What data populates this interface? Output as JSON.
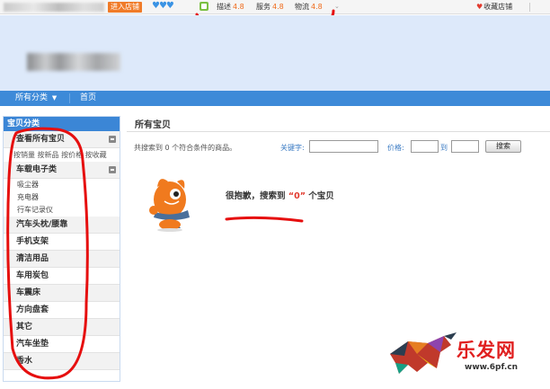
{
  "topbar": {
    "enter_shop": "进入店铺",
    "hearts": "♥♥♥",
    "ratings": [
      {
        "label": "描述",
        "value": "4.8"
      },
      {
        "label": "服务",
        "value": "4.8"
      },
      {
        "label": "物流",
        "value": "4.8"
      }
    ],
    "favorite_label": "收藏店铺"
  },
  "nav": {
    "all_categories": "所有分类",
    "home": "首页"
  },
  "sidebar": {
    "title": "宝贝分类",
    "view_all": "查看所有宝贝",
    "sort_links": "按销量 按新品 按价格 按收藏",
    "categories": [
      {
        "label": "车载电子类",
        "subs": [
          "吸尘器",
          "充电器",
          "行车记录仪"
        ]
      },
      {
        "label": "汽车头枕/腰靠"
      },
      {
        "label": "手机支架"
      },
      {
        "label": "清洁用品"
      },
      {
        "label": "车用炭包"
      },
      {
        "label": "车震床"
      },
      {
        "label": "方向盘套"
      },
      {
        "label": "其它"
      },
      {
        "label": "汽车坐垫"
      },
      {
        "label": "香水"
      }
    ]
  },
  "main": {
    "title": "所有宝贝",
    "result_count": "共搜索到 0 个符合条件的商品。",
    "keyword_label": "关键字:",
    "price_label": "价格:",
    "to_label": "到",
    "search_button": "搜索",
    "sorry_prefix": "很抱歉，搜索到 ",
    "sorry_open_quote": "“",
    "sorry_count": "0",
    "sorry_close_quote": "”",
    "sorry_suffix": " 个宝贝"
  },
  "watermark": {
    "text": "乐发网",
    "url": "www.6pf.cn"
  },
  "colors": {
    "accent_blue": "#3d8ad8",
    "rating_orange": "#f06b1c",
    "annotation_red": "#e60f0f"
  },
  "icons": [
    "wangwang-icon",
    "heart-icon",
    "chevron-down-icon",
    "collapse-icon",
    "mascot-icon",
    "bull-logo-icon"
  ]
}
